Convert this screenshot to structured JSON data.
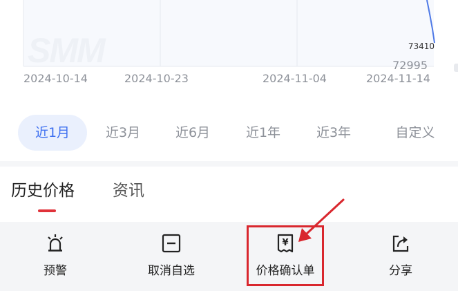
{
  "chart": {
    "watermark": "SMM",
    "x_ticks": [
      "2024-10-14",
      "2024-10-23",
      "2024-11-04",
      "2024-11-14"
    ],
    "value_high": "73410",
    "value_low": "72995",
    "line_color": "#4e79e6"
  },
  "ranges": [
    {
      "label": "近1月",
      "active": true
    },
    {
      "label": "近3月"
    },
    {
      "label": "近6月"
    },
    {
      "label": "近1年"
    },
    {
      "label": "近3年"
    },
    {
      "label": "自定义"
    }
  ],
  "tabs": [
    {
      "label": "历史价格",
      "active": true
    },
    {
      "label": "资讯"
    }
  ],
  "toolbar": [
    {
      "label": "预警",
      "icon": "alarm-light-icon"
    },
    {
      "label": "取消自选",
      "icon": "minus-square-icon"
    },
    {
      "label": "价格确认单",
      "icon": "yen-document-icon"
    },
    {
      "label": "分享",
      "icon": "share-icon"
    }
  ],
  "colors": {
    "accent": "#3d6ff0",
    "highlight": "#d9272e",
    "tab_indicator": "#e0323a"
  }
}
